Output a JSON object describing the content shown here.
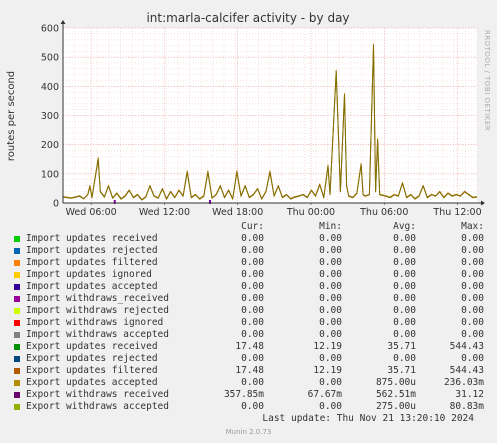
{
  "chart_data": {
    "type": "line",
    "title": "int:marla-calcifer activity - by day",
    "ylabel": "routes per second",
    "ylim": [
      0,
      600
    ],
    "yticks": [
      0,
      100,
      200,
      300,
      400,
      500,
      600
    ],
    "xtick_labels": [
      "Wed 06:00",
      "Wed 12:00",
      "Wed 18:00",
      "Thu 00:00",
      "Thu 06:00",
      "Thu 12:00"
    ],
    "grid": true,
    "series": [
      {
        "name": "Export updates received",
        "color": "#b07010",
        "points": [
          [
            0.0,
            22
          ],
          [
            0.02,
            18
          ],
          [
            0.04,
            25
          ],
          [
            0.05,
            15
          ],
          [
            0.06,
            30
          ],
          [
            0.065,
            60
          ],
          [
            0.07,
            20
          ],
          [
            0.08,
            110
          ],
          [
            0.085,
            155
          ],
          [
            0.09,
            40
          ],
          [
            0.1,
            22
          ],
          [
            0.11,
            60
          ],
          [
            0.12,
            18
          ],
          [
            0.13,
            35
          ],
          [
            0.14,
            15
          ],
          [
            0.15,
            25
          ],
          [
            0.16,
            45
          ],
          [
            0.17,
            20
          ],
          [
            0.18,
            30
          ],
          [
            0.19,
            12
          ],
          [
            0.2,
            22
          ],
          [
            0.21,
            60
          ],
          [
            0.22,
            25
          ],
          [
            0.23,
            18
          ],
          [
            0.24,
            50
          ],
          [
            0.25,
            15
          ],
          [
            0.26,
            40
          ],
          [
            0.27,
            20
          ],
          [
            0.28,
            45
          ],
          [
            0.29,
            25
          ],
          [
            0.3,
            110
          ],
          [
            0.31,
            20
          ],
          [
            0.32,
            30
          ],
          [
            0.33,
            15
          ],
          [
            0.34,
            25
          ],
          [
            0.35,
            110
          ],
          [
            0.36,
            18
          ],
          [
            0.37,
            30
          ],
          [
            0.38,
            60
          ],
          [
            0.39,
            20
          ],
          [
            0.4,
            45
          ],
          [
            0.41,
            15
          ],
          [
            0.42,
            110
          ],
          [
            0.43,
            25
          ],
          [
            0.44,
            60
          ],
          [
            0.45,
            20
          ],
          [
            0.46,
            30
          ],
          [
            0.47,
            50
          ],
          [
            0.48,
            15
          ],
          [
            0.49,
            40
          ],
          [
            0.5,
            110
          ],
          [
            0.51,
            25
          ],
          [
            0.52,
            60
          ],
          [
            0.53,
            20
          ],
          [
            0.54,
            30
          ],
          [
            0.55,
            15
          ],
          [
            0.56,
            22
          ],
          [
            0.57,
            25
          ],
          [
            0.58,
            30
          ],
          [
            0.59,
            20
          ],
          [
            0.6,
            45
          ],
          [
            0.61,
            25
          ],
          [
            0.62,
            65
          ],
          [
            0.63,
            20
          ],
          [
            0.64,
            130
          ],
          [
            0.645,
            30
          ],
          [
            0.66,
            455
          ],
          [
            0.67,
            40
          ],
          [
            0.68,
            375
          ],
          [
            0.685,
            60
          ],
          [
            0.69,
            25
          ],
          [
            0.7,
            20
          ],
          [
            0.71,
            35
          ],
          [
            0.72,
            135
          ],
          [
            0.725,
            30
          ],
          [
            0.73,
            25
          ],
          [
            0.74,
            30
          ],
          [
            0.75,
            544
          ],
          [
            0.755,
            40
          ],
          [
            0.76,
            220
          ],
          [
            0.765,
            30
          ],
          [
            0.78,
            25
          ],
          [
            0.79,
            20
          ],
          [
            0.8,
            30
          ],
          [
            0.81,
            25
          ],
          [
            0.82,
            70
          ],
          [
            0.83,
            20
          ],
          [
            0.84,
            30
          ],
          [
            0.85,
            15
          ],
          [
            0.86,
            25
          ],
          [
            0.87,
            60
          ],
          [
            0.88,
            20
          ],
          [
            0.89,
            30
          ],
          [
            0.9,
            25
          ],
          [
            0.91,
            40
          ],
          [
            0.92,
            20
          ],
          [
            0.93,
            35
          ],
          [
            0.94,
            25
          ],
          [
            0.95,
            30
          ],
          [
            0.96,
            25
          ],
          [
            0.97,
            40
          ],
          [
            0.98,
            30
          ],
          [
            0.99,
            20
          ],
          [
            1.0,
            22
          ]
        ]
      },
      {
        "name": "Export updates filtered",
        "color": "#807000",
        "points": [
          [
            0.0,
            20
          ],
          [
            0.02,
            16
          ],
          [
            0.04,
            23
          ],
          [
            0.05,
            14
          ],
          [
            0.06,
            28
          ],
          [
            0.065,
            55
          ],
          [
            0.07,
            18
          ],
          [
            0.08,
            105
          ],
          [
            0.085,
            150
          ],
          [
            0.09,
            38
          ],
          [
            0.1,
            20
          ],
          [
            0.11,
            58
          ],
          [
            0.12,
            16
          ],
          [
            0.13,
            33
          ],
          [
            0.14,
            13
          ],
          [
            0.15,
            23
          ],
          [
            0.16,
            43
          ],
          [
            0.17,
            18
          ],
          [
            0.18,
            28
          ],
          [
            0.19,
            10
          ],
          [
            0.2,
            20
          ],
          [
            0.21,
            58
          ],
          [
            0.22,
            23
          ],
          [
            0.23,
            16
          ],
          [
            0.24,
            48
          ],
          [
            0.25,
            13
          ],
          [
            0.26,
            38
          ],
          [
            0.27,
            18
          ],
          [
            0.28,
            43
          ],
          [
            0.29,
            23
          ],
          [
            0.3,
            105
          ],
          [
            0.31,
            18
          ],
          [
            0.32,
            28
          ],
          [
            0.33,
            13
          ],
          [
            0.34,
            23
          ],
          [
            0.35,
            105
          ],
          [
            0.36,
            16
          ],
          [
            0.37,
            28
          ],
          [
            0.38,
            58
          ],
          [
            0.39,
            18
          ],
          [
            0.4,
            43
          ],
          [
            0.41,
            13
          ],
          [
            0.42,
            105
          ],
          [
            0.43,
            23
          ],
          [
            0.44,
            58
          ],
          [
            0.45,
            18
          ],
          [
            0.46,
            28
          ],
          [
            0.47,
            48
          ],
          [
            0.48,
            13
          ],
          [
            0.49,
            38
          ],
          [
            0.5,
            105
          ],
          [
            0.51,
            23
          ],
          [
            0.52,
            58
          ],
          [
            0.53,
            18
          ],
          [
            0.54,
            28
          ],
          [
            0.55,
            13
          ],
          [
            0.56,
            20
          ],
          [
            0.57,
            23
          ],
          [
            0.58,
            28
          ],
          [
            0.59,
            18
          ],
          [
            0.6,
            43
          ],
          [
            0.61,
            23
          ],
          [
            0.62,
            62
          ],
          [
            0.63,
            18
          ],
          [
            0.64,
            125
          ],
          [
            0.645,
            28
          ],
          [
            0.66,
            450
          ],
          [
            0.67,
            38
          ],
          [
            0.68,
            370
          ],
          [
            0.685,
            58
          ],
          [
            0.69,
            23
          ],
          [
            0.7,
            18
          ],
          [
            0.71,
            33
          ],
          [
            0.72,
            130
          ],
          [
            0.725,
            28
          ],
          [
            0.73,
            23
          ],
          [
            0.74,
            28
          ],
          [
            0.75,
            540
          ],
          [
            0.755,
            38
          ],
          [
            0.76,
            215
          ],
          [
            0.765,
            28
          ],
          [
            0.78,
            23
          ],
          [
            0.79,
            18
          ],
          [
            0.8,
            28
          ],
          [
            0.81,
            23
          ],
          [
            0.82,
            68
          ],
          [
            0.83,
            18
          ],
          [
            0.84,
            28
          ],
          [
            0.85,
            13
          ],
          [
            0.86,
            23
          ],
          [
            0.87,
            58
          ],
          [
            0.88,
            18
          ],
          [
            0.89,
            28
          ],
          [
            0.9,
            23
          ],
          [
            0.91,
            38
          ],
          [
            0.92,
            18
          ],
          [
            0.93,
            33
          ],
          [
            0.94,
            23
          ],
          [
            0.95,
            28
          ],
          [
            0.96,
            23
          ],
          [
            0.97,
            38
          ],
          [
            0.98,
            28
          ],
          [
            0.99,
            18
          ],
          [
            1.0,
            20
          ]
        ]
      }
    ],
    "markers": [
      {
        "x": 0.125,
        "color": "#7a00a0"
      },
      {
        "x": 0.355,
        "color": "#7a00a0"
      }
    ]
  },
  "legend": {
    "headers": {
      "cur": "Cur:",
      "min": "Min:",
      "avg": "Avg:",
      "max": "Max:"
    },
    "rows": [
      {
        "name": "Import updates received",
        "color": "#00cc00",
        "cur": "0.00",
        "min": "0.00",
        "avg": "0.00",
        "max": "0.00"
      },
      {
        "name": "Import updates rejected",
        "color": "#0066b3",
        "cur": "0.00",
        "min": "0.00",
        "avg": "0.00",
        "max": "0.00"
      },
      {
        "name": "Import updates filtered",
        "color": "#ff8000",
        "cur": "0.00",
        "min": "0.00",
        "avg": "0.00",
        "max": "0.00"
      },
      {
        "name": "Import updates ignored",
        "color": "#ffcc00",
        "cur": "0.00",
        "min": "0.00",
        "avg": "0.00",
        "max": "0.00"
      },
      {
        "name": "Import updates accepted",
        "color": "#330099",
        "cur": "0.00",
        "min": "0.00",
        "avg": "0.00",
        "max": "0.00"
      },
      {
        "name": "Import withdraws_received",
        "color": "#990099",
        "cur": "0.00",
        "min": "0.00",
        "avg": "0.00",
        "max": "0.00"
      },
      {
        "name": "Import withdraws rejected",
        "color": "#ccff00",
        "cur": "0.00",
        "min": "0.00",
        "avg": "0.00",
        "max": "0.00"
      },
      {
        "name": "Import withdraws ignored",
        "color": "#ff0000",
        "cur": "0.00",
        "min": "0.00",
        "avg": "0.00",
        "max": "0.00"
      },
      {
        "name": "Import withdraws accepted",
        "color": "#808080",
        "cur": "0.00",
        "min": "0.00",
        "avg": "0.00",
        "max": "0.00"
      },
      {
        "name": "Export updates received",
        "color": "#008f00",
        "cur": "17.48",
        "min": "12.19",
        "avg": "35.71",
        "max": "544.43"
      },
      {
        "name": "Export updates rejected",
        "color": "#00487d",
        "cur": "0.00",
        "min": "0.00",
        "avg": "0.00",
        "max": "0.00"
      },
      {
        "name": "Export updates filtered",
        "color": "#b35a00",
        "cur": "17.48",
        "min": "12.19",
        "avg": "35.71",
        "max": "544.43"
      },
      {
        "name": "Export updates accepted",
        "color": "#b38f00",
        "cur": "0.00",
        "min": "0.00",
        "avg": "875.00u",
        "max": "236.03m"
      },
      {
        "name": "Export withdraws received",
        "color": "#6b006b",
        "cur": "357.85m",
        "min": "67.67m",
        "avg": "562.51m",
        "max": "31.12"
      },
      {
        "name": "Export withdraws accepted",
        "color": "#8fb300",
        "cur": "0.00",
        "min": "0.00",
        "avg": "275.00u",
        "max": "80.83m"
      }
    ]
  },
  "last_update": "Last update: Thu Nov 21 13:20:10 2024",
  "footer": "Munin 2.0.73",
  "side_text": "RRDTOOL / TOBI OETIKER"
}
